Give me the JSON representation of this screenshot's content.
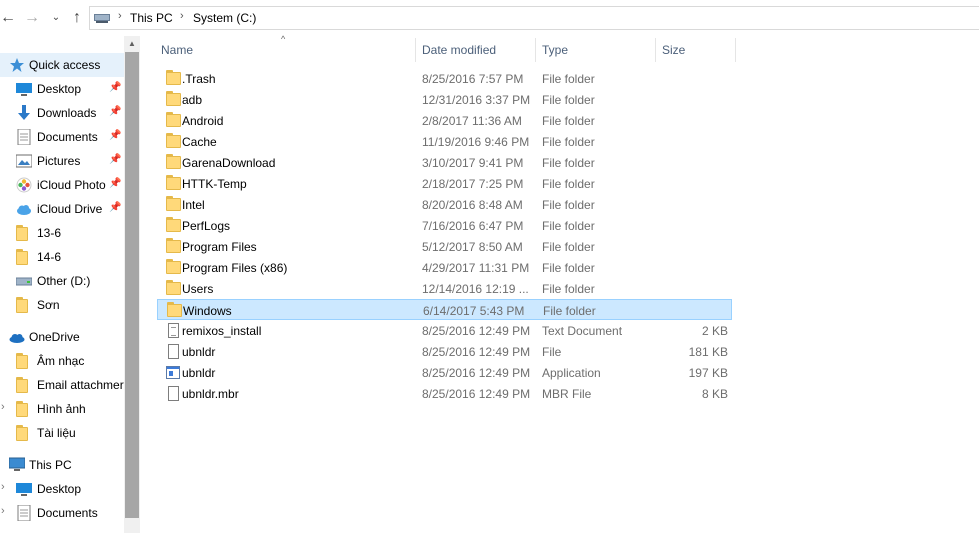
{
  "address_bar": {
    "breadcrumbs": [
      "This PC",
      "System (C:)"
    ]
  },
  "navigation": {
    "quick_access": "Quick access",
    "pinned": [
      {
        "label": "Desktop",
        "icon": "desktop-icon"
      },
      {
        "label": "Downloads",
        "icon": "downloads-icon"
      },
      {
        "label": "Documents",
        "icon": "documents-icon"
      },
      {
        "label": "Pictures",
        "icon": "pictures-icon"
      },
      {
        "label": "iCloud Photo",
        "icon": "icloud-photos-icon"
      },
      {
        "label": "iCloud Drive",
        "icon": "icloud-drive-icon"
      }
    ],
    "recent": [
      "13-6",
      "14-6",
      "Other (D:)",
      "Sơn"
    ],
    "onedrive": "OneDrive",
    "onedrive_items": [
      "Âm nhạc",
      "Email attachmer",
      "Hình ảnh",
      "Tài liệu"
    ],
    "this_pc": "This PC",
    "this_pc_items": [
      "Desktop",
      "Documents"
    ]
  },
  "columns": {
    "name": "Name",
    "date_modified": "Date modified",
    "type": "Type",
    "size": "Size"
  },
  "files": [
    {
      "name": ".Trash",
      "date": "8/25/2016 7:57 PM",
      "type": "File folder",
      "size": "",
      "icon": "folder-icon"
    },
    {
      "name": "adb",
      "date": "12/31/2016 3:37 PM",
      "type": "File folder",
      "size": "",
      "icon": "folder-icon"
    },
    {
      "name": "Android",
      "date": "2/8/2017 11:36 AM",
      "type": "File folder",
      "size": "",
      "icon": "folder-icon"
    },
    {
      "name": "Cache",
      "date": "11/19/2016 9:46 PM",
      "type": "File folder",
      "size": "",
      "icon": "folder-icon"
    },
    {
      "name": "GarenaDownload",
      "date": "3/10/2017 9:41 PM",
      "type": "File folder",
      "size": "",
      "icon": "folder-icon"
    },
    {
      "name": "HTTK-Temp",
      "date": "2/18/2017 7:25 PM",
      "type": "File folder",
      "size": "",
      "icon": "folder-icon"
    },
    {
      "name": "Intel",
      "date": "8/20/2016 8:48 AM",
      "type": "File folder",
      "size": "",
      "icon": "folder-icon"
    },
    {
      "name": "PerfLogs",
      "date": "7/16/2016 6:47 PM",
      "type": "File folder",
      "size": "",
      "icon": "folder-icon"
    },
    {
      "name": "Program Files",
      "date": "5/12/2017 8:50 AM",
      "type": "File folder",
      "size": "",
      "icon": "folder-icon"
    },
    {
      "name": "Program Files (x86)",
      "date": "4/29/2017 11:31 PM",
      "type": "File folder",
      "size": "",
      "icon": "folder-icon"
    },
    {
      "name": "Users",
      "date": "12/14/2016 12:19 ...",
      "type": "File folder",
      "size": "",
      "icon": "folder-icon"
    },
    {
      "name": "Windows",
      "date": "6/14/2017 5:43 PM",
      "type": "File folder",
      "size": "",
      "icon": "folder-icon",
      "selected": true
    },
    {
      "name": "remixos_install",
      "date": "8/25/2016 12:49 PM",
      "type": "Text Document",
      "size": "2 KB",
      "icon": "text-document-icon"
    },
    {
      "name": "ubnldr",
      "date": "8/25/2016 12:49 PM",
      "type": "File",
      "size": "181 KB",
      "icon": "file-icon"
    },
    {
      "name": "ubnldr",
      "date": "8/25/2016 12:49 PM",
      "type": "Application",
      "size": "197 KB",
      "icon": "application-icon"
    },
    {
      "name": "ubnldr.mbr",
      "date": "8/25/2016 12:49 PM",
      "type": "MBR File",
      "size": "8 KB",
      "icon": "file-icon"
    }
  ],
  "colors": {
    "selection_bg": "#cce8ff",
    "selection_border": "#99d1ff",
    "header_text": "#4c607a",
    "quick_access_bg": "#e5f1fb",
    "folder": "#ffd97a"
  }
}
